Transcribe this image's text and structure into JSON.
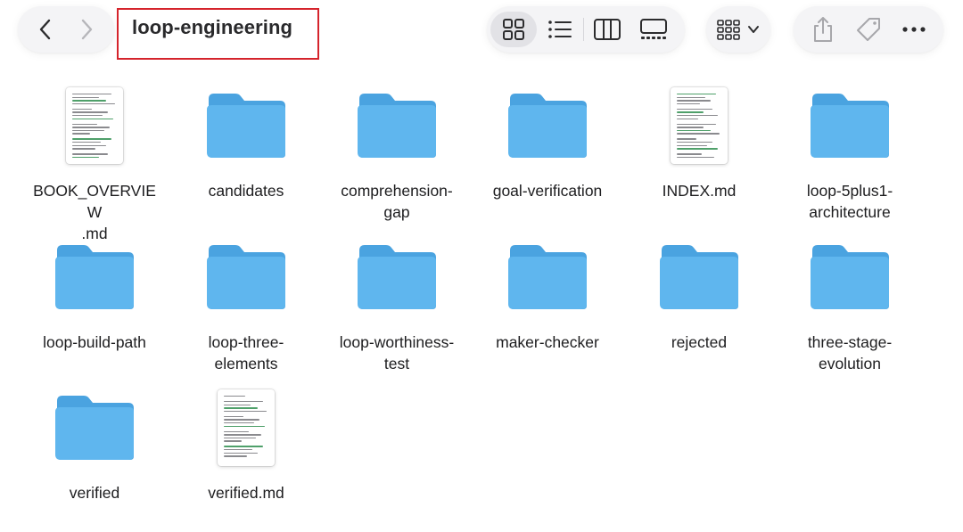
{
  "window": {
    "title": "loop-engineering"
  },
  "toolbar": {
    "back": "back-icon",
    "forward": "forward-icon",
    "views": [
      "icon-view-icon",
      "list-view-icon",
      "column-view-icon",
      "gallery-view-icon"
    ],
    "active_view": "icon-view-icon",
    "group": "group-icon",
    "actions": [
      "share-icon",
      "tag-icon",
      "more-icon"
    ]
  },
  "colors": {
    "folder_front": "#5fb6ee",
    "folder_back": "#4aa3e0",
    "highlight_box": "#d5242c"
  },
  "items": [
    {
      "name": "BOOK_OVERVIEW.md",
      "line1": "BOOK_OVERVIEW",
      "line2": ".md",
      "kind": "document"
    },
    {
      "name": "candidates",
      "line1": "candidates",
      "line2": "",
      "kind": "folder"
    },
    {
      "name": "comprehension-gap",
      "line1": "comprehension-",
      "line2": "gap",
      "kind": "folder"
    },
    {
      "name": "goal-verification",
      "line1": "goal-verification",
      "line2": "",
      "kind": "folder"
    },
    {
      "name": "INDEX.md",
      "line1": "INDEX.md",
      "line2": "",
      "kind": "document"
    },
    {
      "name": "loop-5plus1-architecture",
      "line1": "loop-5plus1-",
      "line2": "architecture",
      "kind": "folder"
    },
    {
      "name": "loop-build-path",
      "line1": "loop-build-path",
      "line2": "",
      "kind": "folder"
    },
    {
      "name": "loop-three-elements",
      "line1": "loop-three-",
      "line2": "elements",
      "kind": "folder"
    },
    {
      "name": "loop-worthiness-test",
      "line1": "loop-worthiness-",
      "line2": "test",
      "kind": "folder"
    },
    {
      "name": "maker-checker",
      "line1": "maker-checker",
      "line2": "",
      "kind": "folder"
    },
    {
      "name": "rejected",
      "line1": "rejected",
      "line2": "",
      "kind": "folder"
    },
    {
      "name": "three-stage-evolution",
      "line1": "three-stage-",
      "line2": "evolution",
      "kind": "folder"
    },
    {
      "name": "verified",
      "line1": "verified",
      "line2": "",
      "kind": "folder"
    },
    {
      "name": "verified.md",
      "line1": "verified.md",
      "line2": "",
      "kind": "document"
    }
  ]
}
